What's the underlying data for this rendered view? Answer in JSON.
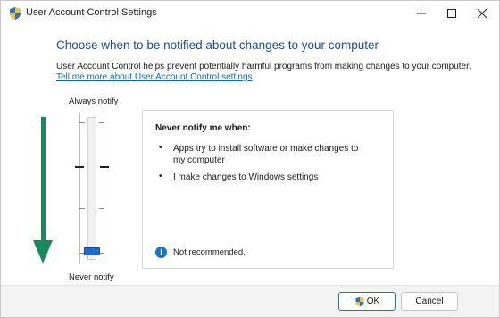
{
  "window": {
    "title": "User Account Control Settings",
    "icons": {
      "app": "uac-shield-icon",
      "minimize": "minimize-icon",
      "maximize": "maximize-icon",
      "close": "close-icon"
    }
  },
  "main": {
    "heading": "Choose when to be notified about changes to your computer",
    "description": "User Account Control helps prevent potentially harmful programs from making changes to your computer.",
    "learn_more_link": "Tell me more about User Account Control settings"
  },
  "slider": {
    "top_label": "Always notify",
    "bottom_label": "Never notify",
    "levels": 4,
    "selected_level": 1
  },
  "panel": {
    "title": "Never notify me when:",
    "bullets": [
      "Apps try to install software or make changes to my computer",
      "I make changes to Windows settings"
    ],
    "note": "Not recommended.",
    "note_icon": "info-icon"
  },
  "buttons": {
    "ok": "OK",
    "cancel": "Cancel"
  },
  "colors": {
    "accent": "#1e6bd6",
    "heading": "#1a4d8f",
    "link": "#1565c0",
    "arrow": "#1a8a5c"
  }
}
